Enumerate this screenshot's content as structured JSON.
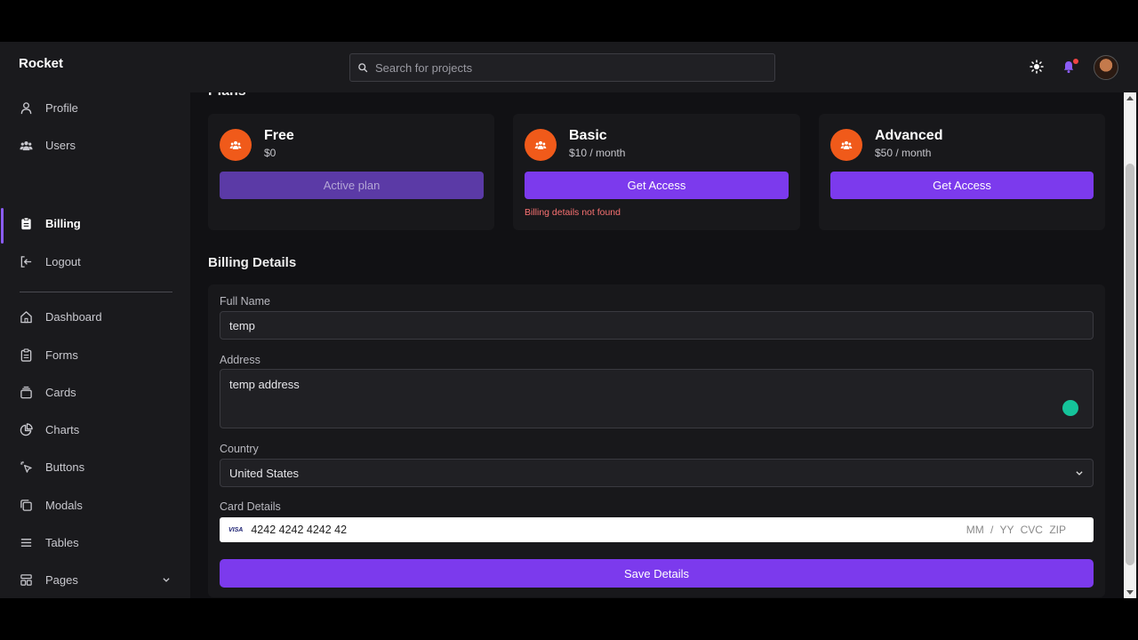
{
  "app": {
    "brand": "Rocket"
  },
  "header": {
    "search_placeholder": "Search for projects",
    "icons": [
      "search-icon",
      "sun-icon",
      "bell-icon",
      "avatar"
    ]
  },
  "sidebar": {
    "account_items": [
      {
        "label": "Profile",
        "icon": "user-icon"
      },
      {
        "label": "Users",
        "icon": "users-icon"
      },
      {
        "label": "Billing",
        "icon": "clipboard-icon",
        "active": true
      },
      {
        "label": "Logout",
        "icon": "logout-icon"
      }
    ],
    "nav_items": [
      {
        "label": "Dashboard",
        "icon": "home-icon"
      },
      {
        "label": "Forms",
        "icon": "clipboard-icon"
      },
      {
        "label": "Cards",
        "icon": "cards-icon"
      },
      {
        "label": "Charts",
        "icon": "pie-chart-icon"
      },
      {
        "label": "Buttons",
        "icon": "cursor-click-icon"
      },
      {
        "label": "Modals",
        "icon": "modal-icon"
      },
      {
        "label": "Tables",
        "icon": "list-icon"
      },
      {
        "label": "Pages",
        "icon": "pages-icon",
        "expandable": true
      }
    ]
  },
  "plans": {
    "title": "Plans",
    "items": [
      {
        "name": "Free",
        "price": "$0",
        "button": "Active plan",
        "disabled": true,
        "error": ""
      },
      {
        "name": "Basic",
        "price": "$10 / month",
        "button": "Get Access",
        "disabled": false,
        "error": "Billing details not found"
      },
      {
        "name": "Advanced",
        "price": "$50 / month",
        "button": "Get Access",
        "disabled": false,
        "error": ""
      }
    ]
  },
  "billing": {
    "title": "Billing Details",
    "full_name_label": "Full Name",
    "full_name_value": "temp",
    "address_label": "Address",
    "address_value": "temp address",
    "country_label": "Country",
    "country_value": "United States",
    "card_label": "Card Details",
    "card_brand": "VISA",
    "card_number": "4242 4242 4242 42",
    "card_expiry_placeholder": "MM / YY",
    "card_cvc_placeholder": "CVC",
    "card_zip_placeholder": "ZIP",
    "save_button": "Save Details"
  },
  "colors": {
    "accent": "#7c3aed",
    "plan_badge": "#f05a1a",
    "error": "#f87171",
    "background": "#111114",
    "panel": "#18181b"
  }
}
